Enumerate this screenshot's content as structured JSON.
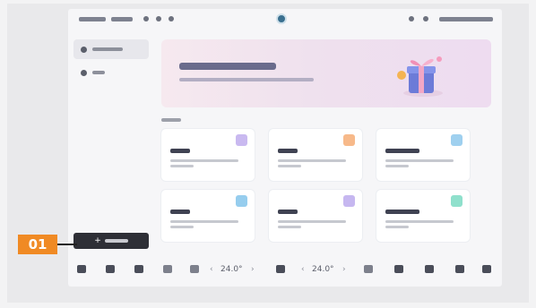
{
  "callout": {
    "number": "01"
  },
  "status_bar": {
    "left_items": [],
    "right_items": []
  },
  "sidebar": {
    "items": [
      {
        "label": "",
        "active": true
      },
      {
        "label": "",
        "active": false
      }
    ]
  },
  "banner": {
    "title": "",
    "subtitle": ""
  },
  "section_label": "",
  "cards": [
    {
      "title": "",
      "description": "",
      "icon": "document-icon",
      "color": "#c9b9f0"
    },
    {
      "title": "",
      "description": "",
      "icon": "document-icon",
      "color": "#f7b98a"
    },
    {
      "title": "",
      "description": "",
      "icon": "document-icon",
      "color": "#9fd0ef"
    },
    {
      "title": "",
      "description": "",
      "icon": "document-icon",
      "color": "#96cdee"
    },
    {
      "title": "",
      "description": "",
      "icon": "document-icon",
      "color": "#c6b7f0"
    },
    {
      "title": "",
      "description": "",
      "icon": "document-icon",
      "color": "#8fe0cc"
    }
  ],
  "new_button": {
    "plus": "+",
    "label": ""
  },
  "dock": {
    "temp_left": "24.0°",
    "temp_right": "24.0°",
    "chevron_left": "‹",
    "chevron_right": "›"
  }
}
